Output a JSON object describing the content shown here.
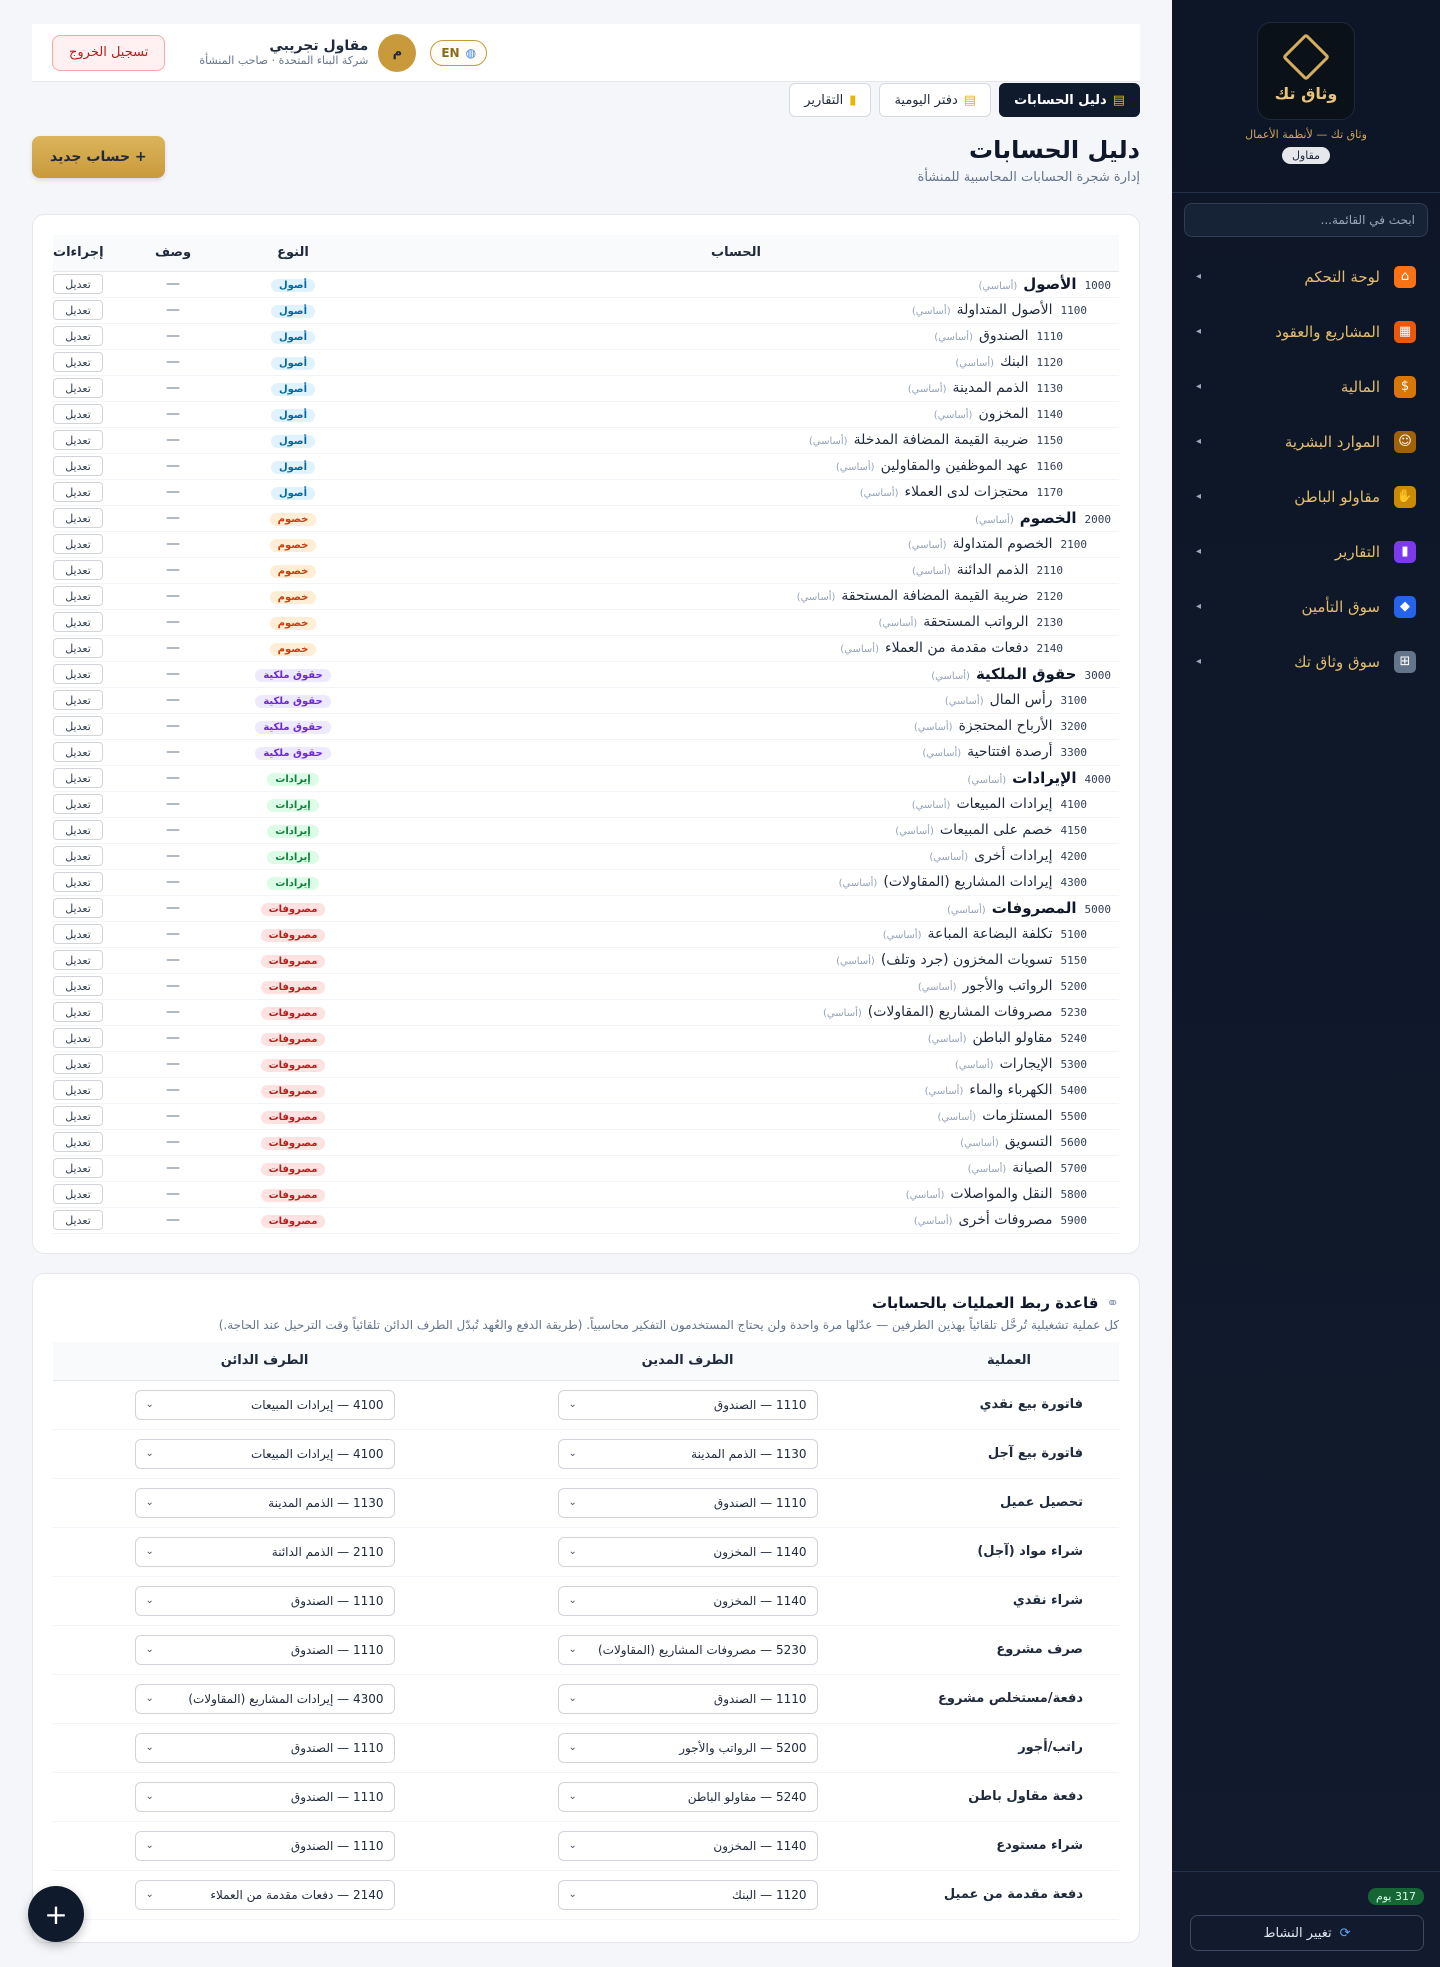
{
  "sidebar": {
    "logo_text": "وثاق تك",
    "tagline": "وثاق تك — لأنظمة الأعمال",
    "role": "مقاول",
    "search_placeholder": "ابحث في القائمة...",
    "items": [
      {
        "label": "لوحة التحكم",
        "icon": "home-icon",
        "glyph": "⌂",
        "color": "#f97316"
      },
      {
        "label": "المشاريع والعقود",
        "icon": "building-icon",
        "glyph": "▦",
        "color": "#ea580c"
      },
      {
        "label": "المالية",
        "icon": "money-bag-icon",
        "glyph": "$",
        "color": "#d97706"
      },
      {
        "label": "الموارد البشرية",
        "icon": "worker-icon",
        "glyph": "☺",
        "color": "#a16207"
      },
      {
        "label": "مقاولو الباطن",
        "icon": "handshake-icon",
        "glyph": "✋",
        "color": "#ca8a04"
      },
      {
        "label": "التقارير",
        "icon": "chart-icon",
        "glyph": "▮",
        "color": "#7c3aed"
      },
      {
        "label": "سوق التأمين",
        "icon": "shield-icon",
        "glyph": "◆",
        "color": "#2563eb"
      },
      {
        "label": "سوق وثاق تك",
        "icon": "cart-icon",
        "glyph": "⊞",
        "color": "#64748b"
      }
    ],
    "days_left": "317 يوم",
    "switch_label": "تغيير النشاط"
  },
  "topbar": {
    "lang": "EN",
    "user_initial": "م",
    "user_name": "مقاول تجريبي",
    "user_sub": "شركة البناء المتحدة · صاحب المنشأة",
    "logout": "تسجيل الخروج"
  },
  "tabs": [
    {
      "label": "دليل الحسابات",
      "icon": "folder-icon",
      "glyph": "▤",
      "active": true
    },
    {
      "label": "دفتر اليومية",
      "icon": "journal-icon",
      "glyph": "▤",
      "active": false
    },
    {
      "label": "التقارير",
      "icon": "chart-icon",
      "glyph": "▮",
      "active": false
    }
  ],
  "page": {
    "title": "دليل الحسابات",
    "subtitle": "إدارة شجرة الحسابات المحاسبية للمنشأة",
    "new_button": "+ حساب جديد"
  },
  "accounts_table": {
    "headers": {
      "account": "الحساب",
      "type": "النوع",
      "desc": "وصف",
      "actions": "إجراءات"
    },
    "basic_label": "(أساسي)",
    "edit_label": "تعديل",
    "dash": "—",
    "rows": [
      {
        "code": "1000",
        "name": "الأصول",
        "type": "أصول",
        "cls": "b-assets",
        "level": 0
      },
      {
        "code": "1100",
        "name": "الأصول المتداولة",
        "type": "أصول",
        "cls": "b-assets",
        "level": 1
      },
      {
        "code": "1110",
        "name": "الصندوق",
        "type": "أصول",
        "cls": "b-assets",
        "level": 2
      },
      {
        "code": "1120",
        "name": "البنك",
        "type": "أصول",
        "cls": "b-assets",
        "level": 2
      },
      {
        "code": "1130",
        "name": "الذمم المدينة",
        "type": "أصول",
        "cls": "b-assets",
        "level": 2
      },
      {
        "code": "1140",
        "name": "المخزون",
        "type": "أصول",
        "cls": "b-assets",
        "level": 2
      },
      {
        "code": "1150",
        "name": "ضريبة القيمة المضافة المدخلة",
        "type": "أصول",
        "cls": "b-assets",
        "level": 2
      },
      {
        "code": "1160",
        "name": "عهد الموظفين والمقاولين",
        "type": "أصول",
        "cls": "b-assets",
        "level": 2
      },
      {
        "code": "1170",
        "name": "محتجزات لدى العملاء",
        "type": "أصول",
        "cls": "b-assets",
        "level": 2
      },
      {
        "code": "2000",
        "name": "الخصوم",
        "type": "خصوم",
        "cls": "b-liab",
        "level": 0
      },
      {
        "code": "2100",
        "name": "الخصوم المتداولة",
        "type": "خصوم",
        "cls": "b-liab",
        "level": 1
      },
      {
        "code": "2110",
        "name": "الذمم الدائنة",
        "type": "خصوم",
        "cls": "b-liab",
        "level": 2
      },
      {
        "code": "2120",
        "name": "ضريبة القيمة المضافة المستحقة",
        "type": "خصوم",
        "cls": "b-liab",
        "level": 2
      },
      {
        "code": "2130",
        "name": "الرواتب المستحقة",
        "type": "خصوم",
        "cls": "b-liab",
        "level": 2
      },
      {
        "code": "2140",
        "name": "دفعات مقدمة من العملاء",
        "type": "خصوم",
        "cls": "b-liab",
        "level": 2
      },
      {
        "code": "3000",
        "name": "حقوق الملكية",
        "type": "حقوق ملكية",
        "cls": "b-equity",
        "level": 0
      },
      {
        "code": "3100",
        "name": "رأس المال",
        "type": "حقوق ملكية",
        "cls": "b-equity",
        "level": 1
      },
      {
        "code": "3200",
        "name": "الأرباح المحتجزة",
        "type": "حقوق ملكية",
        "cls": "b-equity",
        "level": 1
      },
      {
        "code": "3300",
        "name": "أرصدة افتتاحية",
        "type": "حقوق ملكية",
        "cls": "b-equity",
        "level": 1
      },
      {
        "code": "4000",
        "name": "الإيرادات",
        "type": "إيرادات",
        "cls": "b-rev",
        "level": 0
      },
      {
        "code": "4100",
        "name": "إيرادات المبيعات",
        "type": "إيرادات",
        "cls": "b-rev",
        "level": 1
      },
      {
        "code": "4150",
        "name": "خصم على المبيعات",
        "type": "إيرادات",
        "cls": "b-rev",
        "level": 1
      },
      {
        "code": "4200",
        "name": "إيرادات أخرى",
        "type": "إيرادات",
        "cls": "b-rev",
        "level": 1
      },
      {
        "code": "4300",
        "name": "إيرادات المشاريع (المقاولات)",
        "type": "إيرادات",
        "cls": "b-rev",
        "level": 1
      },
      {
        "code": "5000",
        "name": "المصروفات",
        "type": "مصروفات",
        "cls": "b-exp",
        "level": 0
      },
      {
        "code": "5100",
        "name": "تكلفة البضاعة المباعة",
        "type": "مصروفات",
        "cls": "b-exp",
        "level": 1
      },
      {
        "code": "5150",
        "name": "تسويات المخزون (جرد وتلف)",
        "type": "مصروفات",
        "cls": "b-exp",
        "level": 1
      },
      {
        "code": "5200",
        "name": "الرواتب والأجور",
        "type": "مصروفات",
        "cls": "b-exp",
        "level": 1
      },
      {
        "code": "5230",
        "name": "مصروفات المشاريع (المقاولات)",
        "type": "مصروفات",
        "cls": "b-exp",
        "level": 1
      },
      {
        "code": "5240",
        "name": "مقاولو الباطن",
        "type": "مصروفات",
        "cls": "b-exp",
        "level": 1
      },
      {
        "code": "5300",
        "name": "الإيجارات",
        "type": "مصروفات",
        "cls": "b-exp",
        "level": 1
      },
      {
        "code": "5400",
        "name": "الكهرباء والماء",
        "type": "مصروفات",
        "cls": "b-exp",
        "level": 1
      },
      {
        "code": "5500",
        "name": "المستلزمات",
        "type": "مصروفات",
        "cls": "b-exp",
        "level": 1
      },
      {
        "code": "5600",
        "name": "التسويق",
        "type": "مصروفات",
        "cls": "b-exp",
        "level": 1
      },
      {
        "code": "5700",
        "name": "الصيانة",
        "type": "مصروفات",
        "cls": "b-exp",
        "level": 1
      },
      {
        "code": "5800",
        "name": "النقل والمواصلات",
        "type": "مصروفات",
        "cls": "b-exp",
        "level": 1
      },
      {
        "code": "5900",
        "name": "مصروفات أخرى",
        "type": "مصروفات",
        "cls": "b-exp",
        "level": 1
      }
    ]
  },
  "mapping": {
    "title": "قاعدة ربط العمليات بالحسابات",
    "subtitle": "كل عملية تشغيلية تُرحَّل تلقائياً بهذين الطرفين — عدّلها مرة واحدة ولن يحتاج المستخدمون التفكير محاسبياً. (طريقة الدفع والعُهد تُبدّل الطرف الدائن تلقائياً وقت الترحيل عند الحاجة.)",
    "headers": {
      "op": "العملية",
      "debit": "الطرف المدين",
      "credit": "الطرف الدائن"
    },
    "rows": [
      {
        "op": "فاتورة بيع نقدي",
        "debit": "1110 — الصندوق",
        "credit": "4100 — إيرادات المبيعات"
      },
      {
        "op": "فاتورة بيع آجل",
        "debit": "1130 — الذمم المدينة",
        "credit": "4100 — إيرادات المبيعات"
      },
      {
        "op": "تحصيل عميل",
        "debit": "1110 — الصندوق",
        "credit": "1130 — الذمم المدينة"
      },
      {
        "op": "شراء مواد (آجل)",
        "debit": "1140 — المخزون",
        "credit": "2110 — الذمم الدائنة"
      },
      {
        "op": "شراء نقدي",
        "debit": "1140 — المخزون",
        "credit": "1110 — الصندوق"
      },
      {
        "op": "صرف مشروع",
        "debit": "5230 — مصروفات المشاريع (المقاولات)",
        "credit": "1110 — الصندوق"
      },
      {
        "op": "دفعة/مستخلص مشروع",
        "debit": "1110 — الصندوق",
        "credit": "4300 — إيرادات المشاريع (المقاولات)"
      },
      {
        "op": "راتب/أجور",
        "debit": "5200 — الرواتب والأجور",
        "credit": "1110 — الصندوق"
      },
      {
        "op": "دفعة مقاول باطن",
        "debit": "5240 — مقاولو الباطن",
        "credit": "1110 — الصندوق"
      },
      {
        "op": "شراء مستودع",
        "debit": "1140 — المخزون",
        "credit": "1110 — الصندوق"
      },
      {
        "op": "دفعة مقدمة من عميل",
        "debit": "1120 — البنك",
        "credit": "2140 — دفعات مقدمة من العملاء"
      }
    ]
  },
  "fab": "+"
}
